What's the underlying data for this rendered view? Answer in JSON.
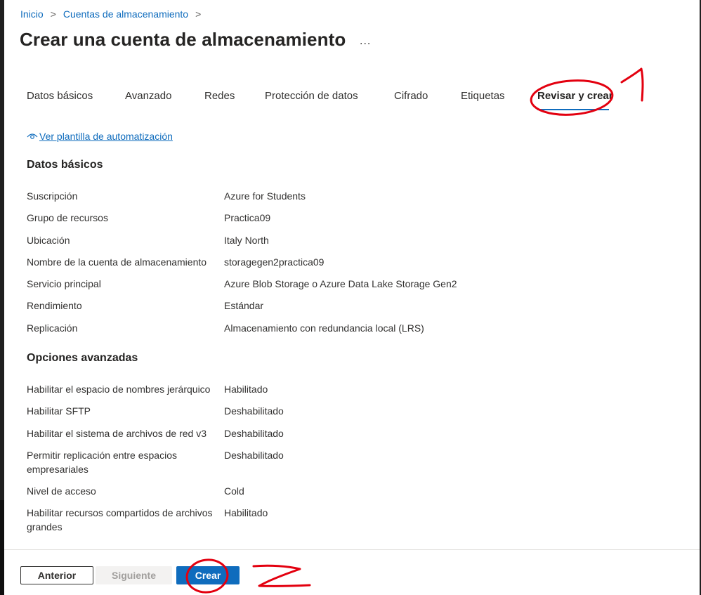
{
  "breadcrumb": {
    "home": "Inicio",
    "storage_accounts": "Cuentas de almacenamiento",
    "separator": ">"
  },
  "page": {
    "title": "Crear una cuenta de almacenamiento",
    "more": "..."
  },
  "tabs": [
    {
      "label": "Datos básicos",
      "active": false
    },
    {
      "label": "Avanzado",
      "active": false
    },
    {
      "label": "Redes",
      "active": false
    },
    {
      "label": "Protección de datos",
      "active": false
    },
    {
      "label": "Cifrado",
      "active": false
    },
    {
      "label": "Etiquetas",
      "active": false
    },
    {
      "label": "Revisar y crear",
      "active": true
    }
  ],
  "automation_link": {
    "label": "Ver plantilla de automatización",
    "icon": "eye-icon"
  },
  "sections": {
    "basics": {
      "title": "Datos básicos",
      "rows": [
        {
          "label": "Suscripción",
          "value": "Azure for Students"
        },
        {
          "label": "Grupo de recursos",
          "value": "Practica09"
        },
        {
          "label": "Ubicación",
          "value": "Italy North"
        },
        {
          "label": "Nombre de la cuenta de almacenamiento",
          "value": "storagegen2practica09"
        },
        {
          "label": "Servicio principal",
          "value": "Azure Blob Storage o Azure Data Lake Storage Gen2"
        },
        {
          "label": "Rendimiento",
          "value": "Estándar"
        },
        {
          "label": "Replicación",
          "value": "Almacenamiento con redundancia local (LRS)"
        }
      ]
    },
    "advanced": {
      "title": "Opciones avanzadas",
      "rows": [
        {
          "label": "Habilitar el espacio de nombres jerárquico",
          "value": "Habilitado"
        },
        {
          "label": "Habilitar SFTP",
          "value": "Deshabilitado"
        },
        {
          "label": "Habilitar el sistema de archivos de red v3",
          "value": "Deshabilitado"
        },
        {
          "label": "Permitir replicación entre espacios empresariales",
          "value": "Deshabilitado"
        },
        {
          "label": "Nivel de acceso",
          "value": "Cold"
        },
        {
          "label": "Habilitar recursos compartidos de archivos grandes",
          "value": "Habilitado"
        }
      ]
    }
  },
  "footer": {
    "previous": "Anterior",
    "next": "Siguiente",
    "create": "Crear"
  },
  "colors": {
    "accent": "#0f6cbd",
    "annotation": "#e3000f"
  }
}
